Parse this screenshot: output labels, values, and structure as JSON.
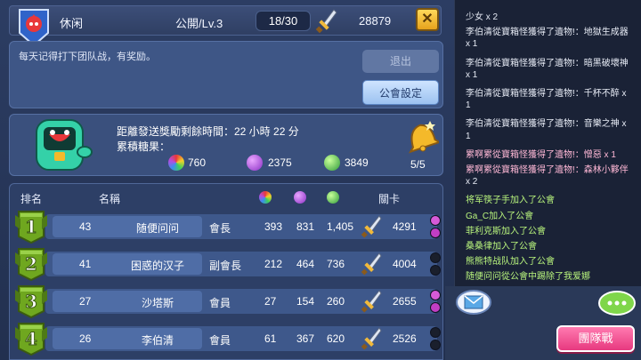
{
  "header": {
    "guild_name": "休闲",
    "guild_level": "公開/Lv.3",
    "member_count": "18/30",
    "power": "28879",
    "close_label": "✕"
  },
  "notice": {
    "text": "每天记得打下团队战，有奖励。",
    "leave_label": "退出",
    "settings_label": "公會設定"
  },
  "reward": {
    "countdown": "距離發送獎勵剩餘時間：22 小時 22 分",
    "accumulated_label": "累積糖果：",
    "candy_rainbow": "760",
    "candy_purple": "2375",
    "candy_green": "3849",
    "bell_count": "5/5"
  },
  "table": {
    "headers": {
      "rank": "排名",
      "name": "名稱",
      "stage": "關卡"
    },
    "rows": [
      {
        "rank": "1",
        "level": "43",
        "name": "随便问问",
        "role": "會長",
        "c1": "393",
        "c2": "831",
        "c3": "1,405",
        "stage": "4291",
        "dots": [
          "#d65ad7",
          "#c03ec4"
        ]
      },
      {
        "rank": "2",
        "level": "41",
        "name": "困惑的汉子",
        "role": "副會長",
        "c1": "212",
        "c2": "464",
        "c3": "736",
        "stage": "4004",
        "dots": [
          "#1a1f2c",
          "#1a1f2c"
        ]
      },
      {
        "rank": "3",
        "level": "27",
        "name": "沙塔斯",
        "role": "會員",
        "c1": "27",
        "c2": "154",
        "c3": "260",
        "stage": "2655",
        "dots": [
          "#d65ad7",
          "#c03ec4"
        ]
      },
      {
        "rank": "4",
        "level": "26",
        "name": "李伯清",
        "role": "會員",
        "c1": "61",
        "c2": "367",
        "c3": "620",
        "stage": "2526",
        "dots": [
          "#1a1f2c",
          "#1a1f2c"
        ]
      }
    ]
  },
  "chat": {
    "lines": [
      {
        "text": "少女 x 2",
        "color": "white"
      },
      {
        "text": "李伯清從寶箱怪獲得了遺物!：地獄生成器",
        "color": "white"
      },
      {
        "text": " x 1",
        "color": "white"
      },
      {
        "text": "李伯清從寶箱怪獲得了遺物!：暗黑破壞神",
        "color": "white"
      },
      {
        "text": " x 1",
        "color": "white"
      },
      {
        "text": "李伯清從寶箱怪獲得了遺物!：千杯不醉 x",
        "color": "white"
      },
      {
        "text": " 1",
        "color": "white"
      },
      {
        "text": "李伯清從寶箱怪獲得了遺物!：音樂之神 x",
        "color": "white"
      },
      {
        "text": " 1",
        "color": "white"
      },
      {
        "text": "累啊累從寶箱怪獲得了遺物!：憎惡 x 1",
        "color": "pink"
      },
      {
        "text": "累啊累從寶箱怪獲得了遺物!：森林小夥伴",
        "color": "pink"
      },
      {
        "text": " x 2",
        "color": "white"
      },
      {
        "text": "将军筷子手加入了公會",
        "color": "green"
      },
      {
        "text": "Ga_C加入了公會",
        "color": "green"
      },
      {
        "text": "菲利克斯加入了公會",
        "color": "green"
      },
      {
        "text": "桑桑律加入了公會",
        "color": "green"
      },
      {
        "text": "熊熊特战队加入了公會",
        "color": "green"
      },
      {
        "text": "随便问问從公會中踢除了我爱娜",
        "color": "green"
      }
    ],
    "raid_label": "團隊戰"
  },
  "colors": {
    "accent_yellow": "#f4b92a",
    "raid_pink": "#e7397f",
    "rank_green": "#6fa71f"
  }
}
